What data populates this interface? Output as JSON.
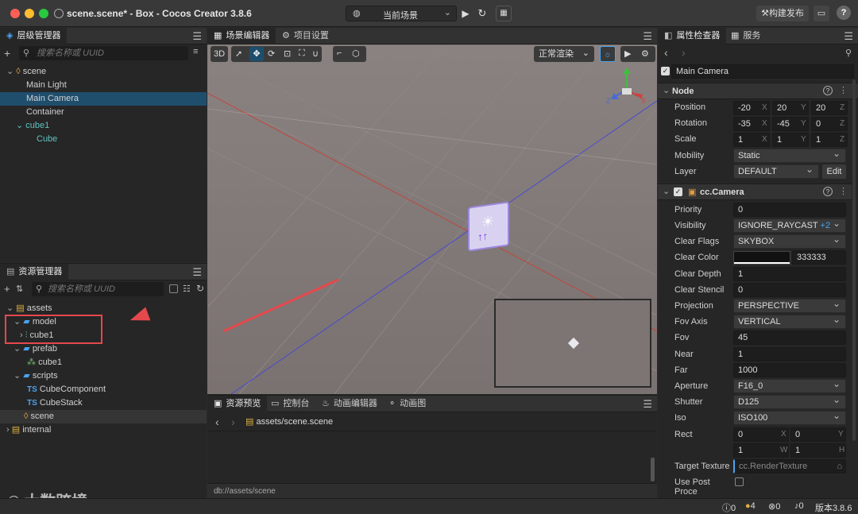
{
  "app": {
    "title": "scene.scene* - Box - Cocos Creator 3.8.6",
    "scene_select": "当前场景",
    "build_label": "构建发布"
  },
  "hierarchy": {
    "tab": "层级管理器",
    "search_placeholder": "搜索名称或 UUID",
    "items": [
      {
        "label": "scene"
      },
      {
        "label": "Main Light"
      },
      {
        "label": "Main Camera"
      },
      {
        "label": "Container"
      },
      {
        "label": "cube1"
      },
      {
        "label": "Cube"
      }
    ]
  },
  "assets": {
    "tab": "资源管理器",
    "search_placeholder": "搜索名称或 UUID",
    "items": [
      {
        "label": "assets"
      },
      {
        "label": "model"
      },
      {
        "label": "cube1"
      },
      {
        "label": "prefab"
      },
      {
        "label": "cube1"
      },
      {
        "label": "scripts"
      },
      {
        "label": "CubeComponent"
      },
      {
        "label": "CubeStack"
      },
      {
        "label": "scene"
      },
      {
        "label": "internal"
      }
    ],
    "ts_badge": "TS"
  },
  "scene_editor": {
    "tabs": [
      "场景编辑器",
      "项目设置"
    ],
    "btn_3d": "3D",
    "render_mode": "正常渲染"
  },
  "bottom": {
    "tabs": [
      "资源预览",
      "控制台",
      "动画编辑器",
      "动画图"
    ],
    "path_root": "assets",
    "path_sep": "/",
    "path_file": "scene.scene",
    "db_path": "db://assets/scene"
  },
  "inspector": {
    "tabs": [
      "属性检查器",
      "服务"
    ],
    "node_name": "Main Camera",
    "node_section": "Node",
    "position": {
      "label": "Position",
      "x": "-20",
      "y": "20",
      "z": "20"
    },
    "rotation": {
      "label": "Rotation",
      "x": "-35",
      "y": "-45",
      "z": "0"
    },
    "scale": {
      "label": "Scale",
      "x": "1",
      "y": "1",
      "z": "1"
    },
    "mobility": {
      "label": "Mobility",
      "value": "Static"
    },
    "layer": {
      "label": "Layer",
      "value": "DEFAULT",
      "edit": "Edit"
    },
    "camera_section": "cc.Camera",
    "priority": {
      "label": "Priority",
      "value": "0"
    },
    "visibility": {
      "label": "Visibility",
      "value": "IGNORE_RAYCAST",
      "extra": "+2"
    },
    "clear_flags": {
      "label": "Clear Flags",
      "value": "SKYBOX"
    },
    "clear_color": {
      "label": "Clear Color",
      "value": "333333"
    },
    "clear_depth": {
      "label": "Clear Depth",
      "value": "1"
    },
    "clear_stencil": {
      "label": "Clear Stencil",
      "value": "0"
    },
    "projection": {
      "label": "Projection",
      "value": "PERSPECTIVE"
    },
    "fov_axis": {
      "label": "Fov Axis",
      "value": "VERTICAL"
    },
    "fov": {
      "label": "Fov",
      "value": "45"
    },
    "near": {
      "label": "Near",
      "value": "1"
    },
    "far": {
      "label": "Far",
      "value": "1000"
    },
    "aperture": {
      "label": "Aperture",
      "value": "F16_0"
    },
    "shutter": {
      "label": "Shutter",
      "value": "D125"
    },
    "iso": {
      "label": "Iso",
      "value": "ISO100"
    },
    "rect": {
      "label": "Rect",
      "x": "0",
      "y": "0",
      "w": "1",
      "h": "1"
    },
    "target_texture": {
      "label": "Target Texture",
      "placeholder": "cc.RenderTexture"
    },
    "use_post": {
      "label": "Use Post Proce"
    }
  },
  "axis_letters": {
    "x": "X",
    "y": "Y",
    "z": "Z",
    "w": "W",
    "h": "H"
  },
  "status": {
    "info": "0",
    "warn": "4",
    "error": "0",
    "notice": "0",
    "version": "版本3.8.6"
  },
  "watermark": "大数跨境",
  "colors": {
    "accent": "#2a88d8",
    "selected": "#1f4e6d",
    "highlight_box": "#e5484d",
    "viewport": "#7c7472"
  }
}
